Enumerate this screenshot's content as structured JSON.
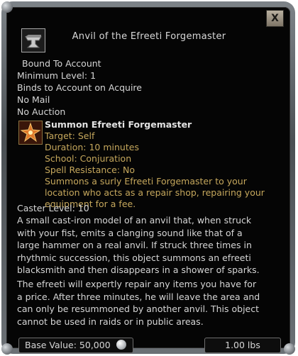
{
  "tooltip": {
    "title": "Anvil of the Efreeti Forgemaster",
    "close_label": "X",
    "properties": [
      "Bound To Account",
      "Minimum Level: 1",
      "Binds to Account on Acquire",
      "No Mail",
      "No Auction"
    ],
    "spell": {
      "name": "Summon Efreeti Forgemaster",
      "target": "Target: Self",
      "duration": "Duration: 10 minutes",
      "school": "School: Conjuration",
      "resistance": "Spell Resistance: No",
      "description_lines": [
        "Summons a surly Efreeti Forgemaster to your",
        "location who acts as a repair shop, repairing your",
        "equipment for a fee."
      ]
    },
    "caster_level": "Caster Level: 10",
    "description_p1": [
      "A small cast-iron model of an anvil that, when struck",
      "with your fist, emits a clanging sound like that of a",
      "large hammer on a real anvil. If struck three times in",
      "rhythmic succession, this object summons an efreeti",
      "blacksmith and then disappears in a shower of sparks."
    ],
    "description_p2": [
      "The efreeti will expertly repair any items you have for",
      "a price. After three minutes, he will leave the area and",
      "can only be resummoned by another anvil. This object",
      "cannot be used in raids or in public areas."
    ],
    "footer": {
      "base_value": "Base Value: 50,000",
      "weight": "1.00 lbs"
    }
  },
  "colors": {
    "background": "#050505",
    "text": "#d6d6d6",
    "spell_detail": "#c5a75c"
  }
}
